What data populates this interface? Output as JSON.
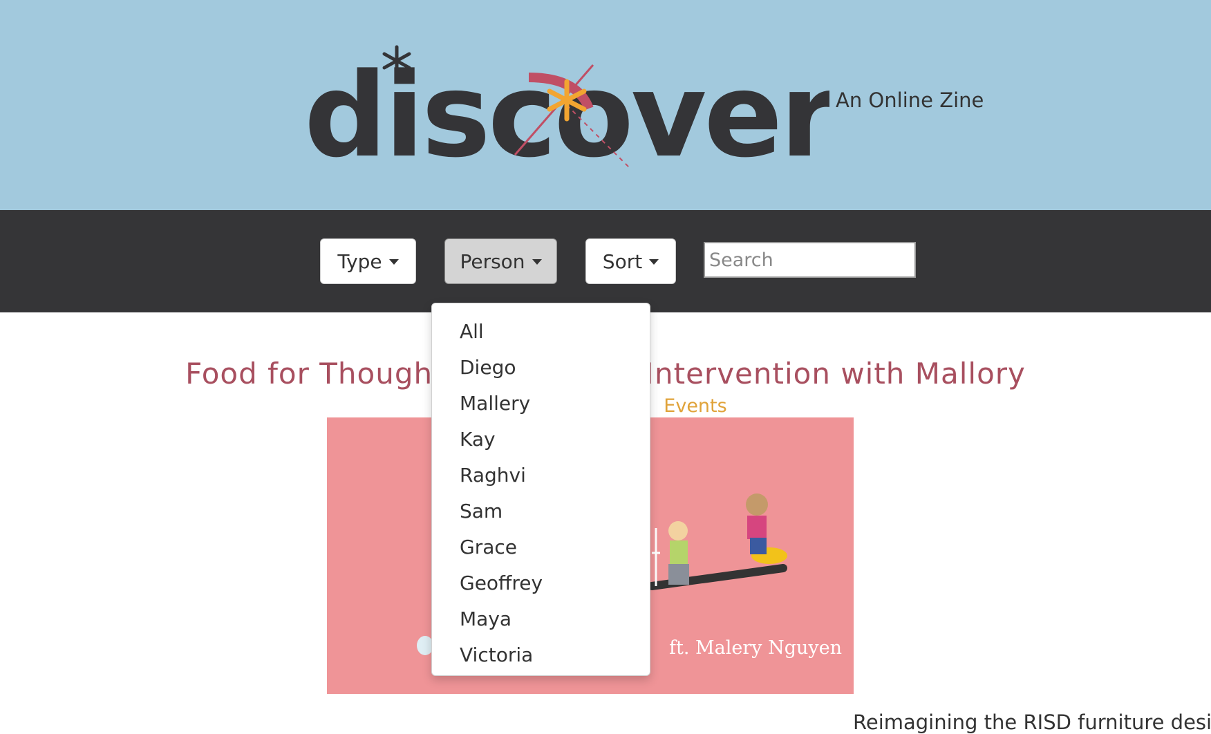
{
  "header": {
    "logo_text": "discover",
    "tagline": "An Online Zine"
  },
  "nav": {
    "type_label": "Type",
    "person_label": "Person",
    "sort_label": "Sort",
    "search_placeholder": "Search"
  },
  "person_menu": {
    "items": [
      "All",
      "Diego",
      "Mallery",
      "Kay",
      "Raghvi",
      "Sam",
      "Grace",
      "Geoffrey",
      "Maya",
      "Victoria"
    ]
  },
  "post": {
    "title": "Food for Thought: Playground Intervention with Mallory",
    "category": "Events",
    "image_caption": "ft. Malery Nguyen",
    "excerpt": "Reimagining the RISD furniture design"
  },
  "colors": {
    "header_bg": "#a2c9dd",
    "navbar_bg": "#353537",
    "title": "#a84f5f",
    "category": "#e0a33a",
    "image_bg": "#ef9497"
  }
}
